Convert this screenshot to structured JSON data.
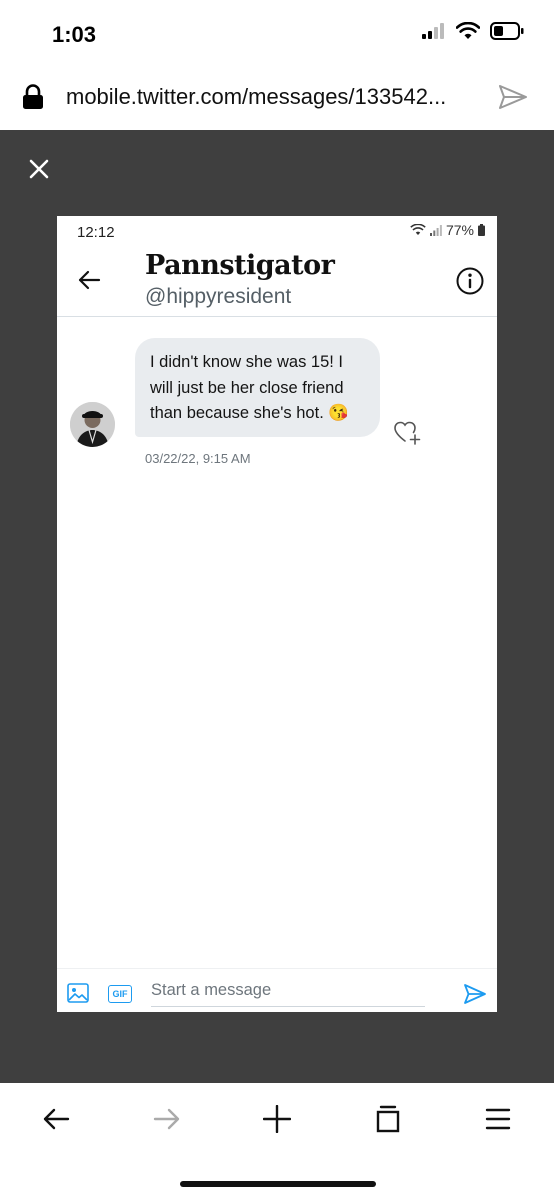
{
  "status_bar": {
    "time": "1:03"
  },
  "browser": {
    "url": "mobile.twitter.com/messages/133542..."
  },
  "screenshot": {
    "status_time": "12:12",
    "battery": "77%",
    "display_name": "Pannstigator",
    "handle": "@hippyresident",
    "message": {
      "text": "I didn't know she was 15! I will just be her close friend than because she's hot. 😘",
      "timestamp": "03/22/22, 9:15 AM"
    },
    "composer": {
      "placeholder": "Start a message",
      "gif_label": "GIF"
    }
  },
  "colors": {
    "accent": "#1d9bf0",
    "viewer_bg": "#3f3f3f",
    "bubble_bg": "#e9ecef"
  }
}
